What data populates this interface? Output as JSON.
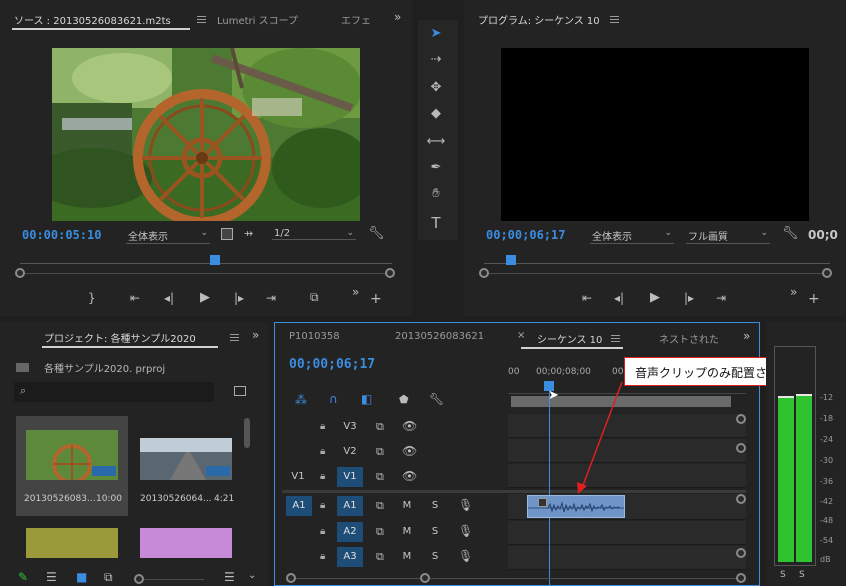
{
  "source_panel": {
    "tab_source": "ソース : 20130526083621.m2ts",
    "tab_lumetri": "Lumetri スコープ",
    "tab_effects": "エフェ",
    "timecode": "00:00:05:10",
    "fit_dropdown": "全体表示",
    "resolution_dropdown": "1/2"
  },
  "program_panel": {
    "title": "プログラム: シーケンス 10",
    "timecode": "00;00;06;17",
    "fit_dropdown": "全体表示",
    "quality_dropdown": "フル画質",
    "timecode_right": "00;0"
  },
  "project_panel": {
    "title": "プロジェクト: 各種サンプル2020",
    "project_file": "各種サンプル2020. prproj",
    "items": [
      {
        "name": "20130526083...",
        "duration": "10:00"
      },
      {
        "name": "20130526064...",
        "duration": "4:21"
      }
    ]
  },
  "timeline_panel": {
    "tabs": [
      "P1010358",
      "20130526083621",
      "シーケンス 10",
      "ネストされた"
    ],
    "timecode": "00;00;06;17",
    "ruler_left": "00",
    "ruler_mid": "00;00;08;00",
    "ruler_right": "00",
    "tracks": {
      "v3": "V3",
      "v2": "V2",
      "v1": "V1",
      "v1_src": "V1",
      "a1": "A1",
      "a1_src": "A1",
      "a2": "A2",
      "a3": "A3",
      "m": "M",
      "s": "S"
    },
    "annotation": "音声クリップのみ配置される"
  },
  "audio_meter": {
    "scale": [
      "-12",
      "-18",
      "-24",
      "-30",
      "-36",
      "-42",
      "-48",
      "-54",
      "dB"
    ],
    "solo_labels": [
      "S",
      "S"
    ]
  },
  "colors": {
    "accent_blue": "#3b8de0",
    "annotation_red": "#e02020",
    "meter_green": "#2fc42f"
  }
}
